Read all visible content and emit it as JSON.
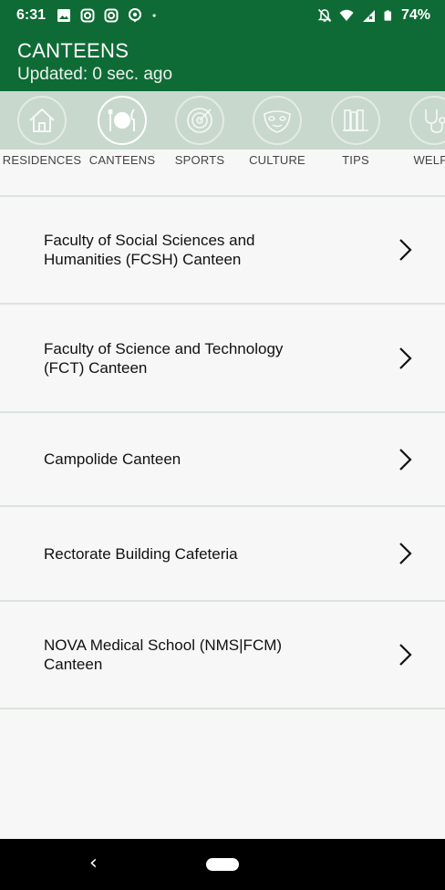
{
  "status_bar": {
    "time": "6:31",
    "left_icons": [
      "image-icon",
      "instagram-icon",
      "instagram-icon",
      "location-pin-icon",
      "dot-icon"
    ],
    "right_icons": [
      "mute-bell-icon",
      "wifi-icon",
      "signal-icon",
      "battery-icon"
    ],
    "battery": "74%"
  },
  "app_bar": {
    "title": "CANTEENS",
    "subtitle": "Updated: 0 sec. ago",
    "color": "#0f6b36"
  },
  "tabs": [
    {
      "label": "RESIDENCES",
      "icon": "house-icon",
      "active": false
    },
    {
      "label": "CANTEENS",
      "icon": "plate-cutlery-icon",
      "active": true
    },
    {
      "label": "SPORTS",
      "icon": "target-icon",
      "active": false
    },
    {
      "label": "CULTURE",
      "icon": "theater-mask-icon",
      "active": false
    },
    {
      "label": "TIPS",
      "icon": "books-icon",
      "active": false
    },
    {
      "label": "WELFA",
      "icon": "stethoscope-icon",
      "active": false
    }
  ],
  "canteens": [
    {
      "name": "Faculty of Social Sciences and Humanities (FCSH) Canteen"
    },
    {
      "name": "Faculty of Science and Technology (FCT) Canteen"
    },
    {
      "name": "Campolide Canteen"
    },
    {
      "name": "Rectorate Building Cafeteria"
    },
    {
      "name": "NOVA Medical School (NMS|FCM) Canteen"
    }
  ],
  "nav_bar": {
    "back_glyph": "‹"
  }
}
